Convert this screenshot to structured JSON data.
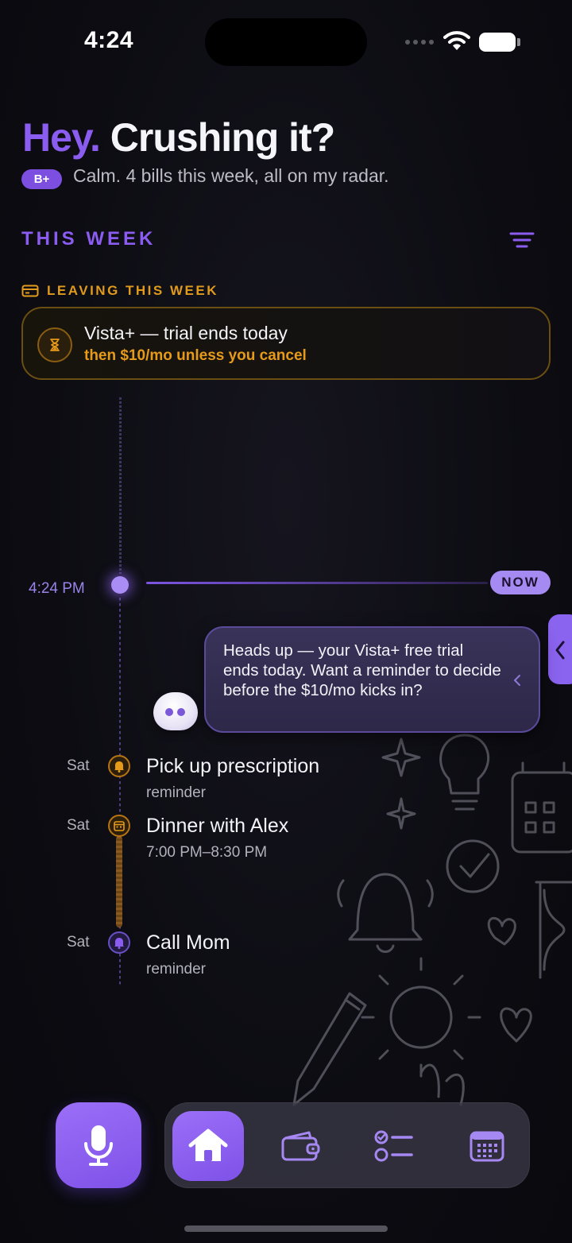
{
  "status_bar": {
    "time": "4:24"
  },
  "header": {
    "greeting_accent": "Hey.",
    "greeting_rest": " Crushing it?",
    "grade": "B+",
    "subtitle": "Calm. 4 bills this week, all on my radar."
  },
  "section": {
    "title": "THIS WEEK",
    "filter_icon": "filter-lines-icon"
  },
  "leaving": {
    "label": "LEAVING THIS WEEK",
    "icon": "credit-card-icon",
    "card": {
      "icon": "hourglass-icon",
      "title": "Vista+ — trial ends today",
      "subtitle": "then $10/mo unless you cancel"
    }
  },
  "timeline": {
    "now_time": "4:24 PM",
    "now_label": "NOW",
    "assistant_message": "Heads up — your Vista+ free trial ends today. Want a reminder to decide before the $10/mo kicks in?",
    "events": [
      {
        "day": "Sat",
        "title": "Pick up prescription",
        "subtitle": "reminder",
        "icon": "bell-icon"
      },
      {
        "day": "Sat",
        "title": "Dinner with Alex",
        "subtitle": "7:00 PM–8:30 PM",
        "icon": "calendar-icon"
      },
      {
        "day": "Sat",
        "title": "Call Mom",
        "subtitle": "reminder",
        "icon": "bell-icon"
      }
    ]
  },
  "tabbar": {
    "mic": "microphone-icon",
    "tabs": [
      {
        "icon": "home-icon",
        "active": true
      },
      {
        "icon": "wallet-icon",
        "active": false
      },
      {
        "icon": "checklist-icon",
        "active": false
      },
      {
        "icon": "calendar-icon",
        "active": false
      }
    ]
  },
  "colors": {
    "accent": "#8b5cf0",
    "warning": "#e69a1a",
    "background": "#0c0c12"
  }
}
